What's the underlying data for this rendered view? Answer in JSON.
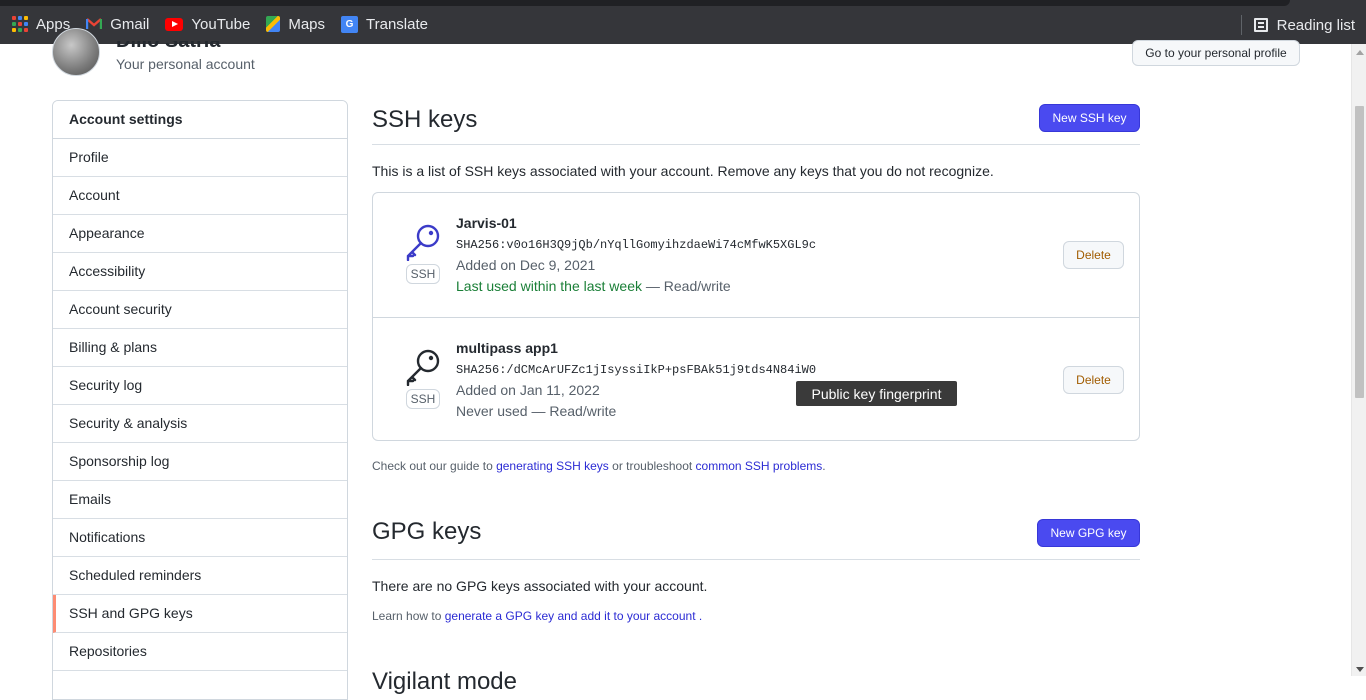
{
  "bookmarks": {
    "items": [
      {
        "label": "Apps",
        "icon": "apps-grid-icon"
      },
      {
        "label": "Gmail",
        "icon": "gmail-icon"
      },
      {
        "label": "YouTube",
        "icon": "youtube-icon"
      },
      {
        "label": "Maps",
        "icon": "maps-icon"
      },
      {
        "label": "Translate",
        "icon": "translate-icon"
      }
    ],
    "reading_list": "Reading list"
  },
  "header": {
    "user_name": "Dillo Satria",
    "subtitle": "Your personal account",
    "profile_button": "Go to your personal profile"
  },
  "sidebar": {
    "heading": "Account settings",
    "items": [
      {
        "label": "Profile"
      },
      {
        "label": "Account"
      },
      {
        "label": "Appearance"
      },
      {
        "label": "Accessibility"
      },
      {
        "label": "Account security"
      },
      {
        "label": "Billing & plans"
      },
      {
        "label": "Security log"
      },
      {
        "label": "Security & analysis"
      },
      {
        "label": "Sponsorship log"
      },
      {
        "label": "Emails"
      },
      {
        "label": "Notifications"
      },
      {
        "label": "Scheduled reminders"
      },
      {
        "label": "SSH and GPG keys",
        "active": true
      },
      {
        "label": "Repositories"
      }
    ]
  },
  "ssh": {
    "title": "SSH keys",
    "new_button": "New SSH key",
    "intro": "This is a list of SSH keys associated with your account. Remove any keys that you do not recognize.",
    "keys": [
      {
        "tag": "SSH",
        "name": "Jarvis-01",
        "fingerprint": "SHA256:v0o16H3Q9jQb/nYqllGomyihzdaeWi74cMfwK5XGL9c",
        "added": "Added on Dec 9, 2021",
        "used_highlight": "Last used within the last week",
        "used_rest": " — Read/write",
        "delete": "Delete"
      },
      {
        "tag": "SSH",
        "name": "multipass app1",
        "fingerprint": "SHA256:/dCMcArUFZc1jIsyssiIkP+psFBAk51j9tds4N84iW0",
        "added": "Added on Jan 11, 2022",
        "used_highlight": "",
        "used_rest": "Never used — Read/write",
        "delete": "Delete"
      }
    ],
    "tooltip": "Public key fingerprint",
    "guide_prefix": "Check out our guide to ",
    "guide_link1": "generating SSH keys",
    "guide_middle": " or troubleshoot ",
    "guide_link2": "common SSH problems",
    "guide_suffix": "."
  },
  "gpg": {
    "title": "GPG keys",
    "new_button": "New GPG key",
    "none": "There are no GPG keys associated with your account.",
    "learn_prefix": "Learn how to ",
    "learn_link": "generate a GPG key and add it to your account",
    "learn_suffix": " ."
  },
  "vigilant_title": "Vigilant mode",
  "colors": {
    "primary_button": "#4a4af0",
    "link": "#2b2bd4",
    "active_marker": "#fd8c73",
    "used_green": "#1a7f37"
  }
}
